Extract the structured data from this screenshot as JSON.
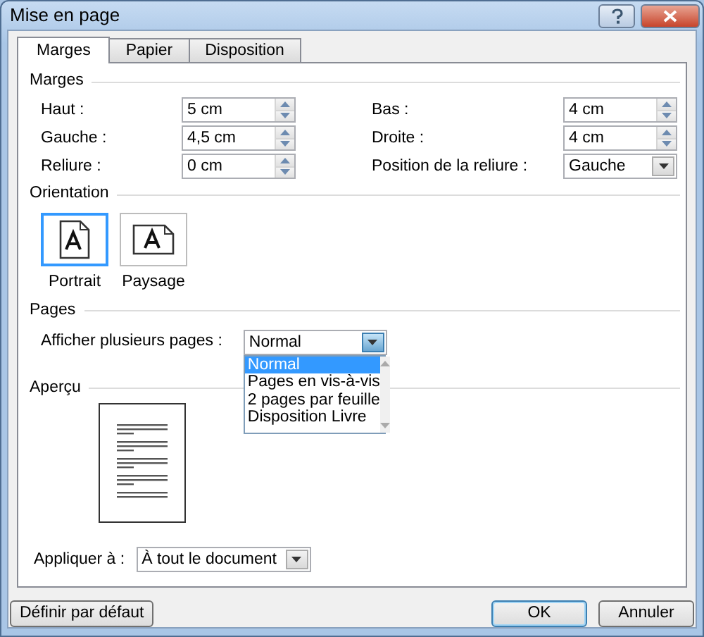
{
  "window": {
    "title": "Mise en page"
  },
  "tabs": [
    {
      "label": "Marges",
      "selected": true
    },
    {
      "label": "Papier",
      "selected": false
    },
    {
      "label": "Disposition",
      "selected": false
    }
  ],
  "margins": {
    "title": "Marges",
    "fields": [
      {
        "label": "Haut :",
        "value": "5 cm",
        "kind": "spin"
      },
      {
        "label": "Bas :",
        "value": "4 cm",
        "kind": "spin"
      },
      {
        "label": "Gauche :",
        "value": "4,5 cm",
        "kind": "spin"
      },
      {
        "label": "Droite :",
        "value": "4 cm",
        "kind": "spin"
      },
      {
        "label": "Reliure :",
        "value": "0 cm",
        "kind": "spin"
      },
      {
        "label": "Position de la reliure :",
        "value": "Gauche",
        "kind": "select"
      }
    ]
  },
  "orientation": {
    "title": "Orientation",
    "options": [
      {
        "label": "Portrait",
        "selected": true,
        "kind": "portrait"
      },
      {
        "label": "Paysage",
        "selected": false,
        "kind": "landscape"
      }
    ]
  },
  "pages": {
    "title": "Pages",
    "label": "Afficher plusieurs pages :",
    "value": "Normal",
    "expanded": true,
    "options": [
      {
        "label": "Normal",
        "selected": true
      },
      {
        "label": "Pages en vis-à-vis",
        "selected": false
      },
      {
        "label": "2 pages par feuille",
        "selected": false
      },
      {
        "label": "Disposition Livre",
        "selected": false
      }
    ]
  },
  "preview": {
    "title": "Aperçu"
  },
  "apply": {
    "label": "Appliquer à :",
    "value": "À tout le document"
  },
  "buttons": [
    {
      "label": "Définir par défaut",
      "default": false
    },
    {
      "label": "OK",
      "default": true
    },
    {
      "label": "Annuler",
      "default": false
    }
  ]
}
